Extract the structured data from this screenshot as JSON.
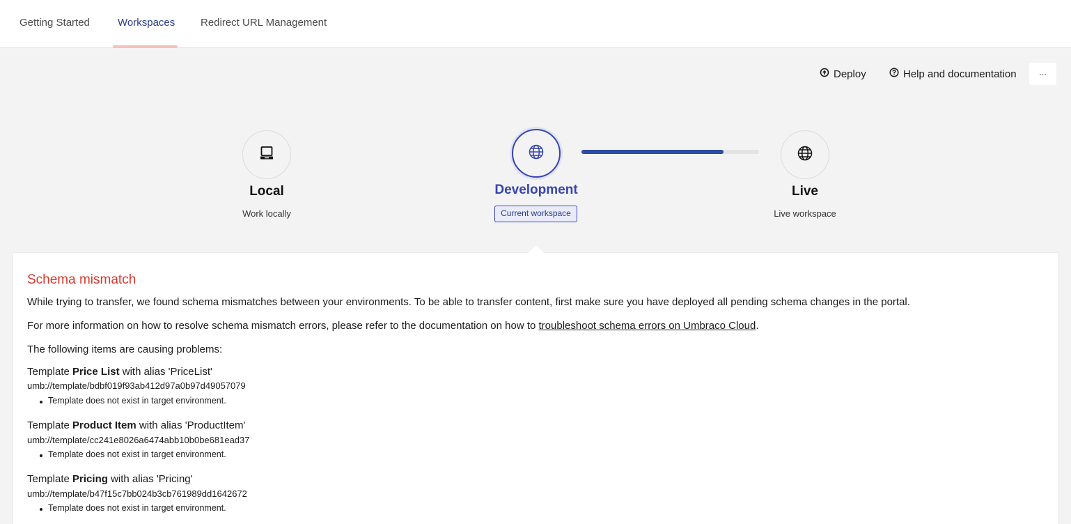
{
  "tabs": [
    {
      "label": "Getting Started"
    },
    {
      "label": "Workspaces"
    },
    {
      "label": "Redirect URL Management"
    }
  ],
  "toolbar": {
    "deploy_label": "Deploy",
    "help_label": "Help and documentation",
    "more_label": "..."
  },
  "workspaces": {
    "local": {
      "name": "Local",
      "subtitle": "Work locally",
      "icon": "laptop-icon"
    },
    "development": {
      "name": "Development",
      "badge": "Current workspace",
      "icon": "globe-icon"
    },
    "live": {
      "name": "Live",
      "subtitle": "Live workspace",
      "icon": "globe-icon"
    }
  },
  "transfer_progress": 0.8,
  "colors": {
    "accent": "#3544b1",
    "error": "#d9352c",
    "progress": "#2b4ea0"
  },
  "panel": {
    "title": "Schema mismatch",
    "para1": "While trying to transfer, we found schema mismatches between your environments. To be able to transfer content, first make sure you have deployed all pending schema changes in the portal.",
    "para2_before": "For more information on how to resolve schema mismatch errors, please refer to the documentation on how to ",
    "para2_link": "troubleshoot schema errors on Umbraco Cloud",
    "para2_after": ".",
    "para3": "The following items are causing problems:",
    "items": [
      {
        "prefix": "Template ",
        "name": "Price List",
        "suffix": " with alias 'PriceList'",
        "uri": "umb://template/bdbf019f93ab412d97a0b97d49057079",
        "error": "Template does not exist in target environment."
      },
      {
        "prefix": "Template ",
        "name": "Product Item",
        "suffix": " with alias 'ProductItem'",
        "uri": "umb://template/cc241e8026a6474abb10b0be681ead37",
        "error": "Template does not exist in target environment."
      },
      {
        "prefix": "Template ",
        "name": "Pricing",
        "suffix": " with alias 'Pricing'",
        "uri": "umb://template/b47f15c7bb024b3cb761989dd1642672",
        "error": "Template does not exist in target environment."
      }
    ]
  }
}
